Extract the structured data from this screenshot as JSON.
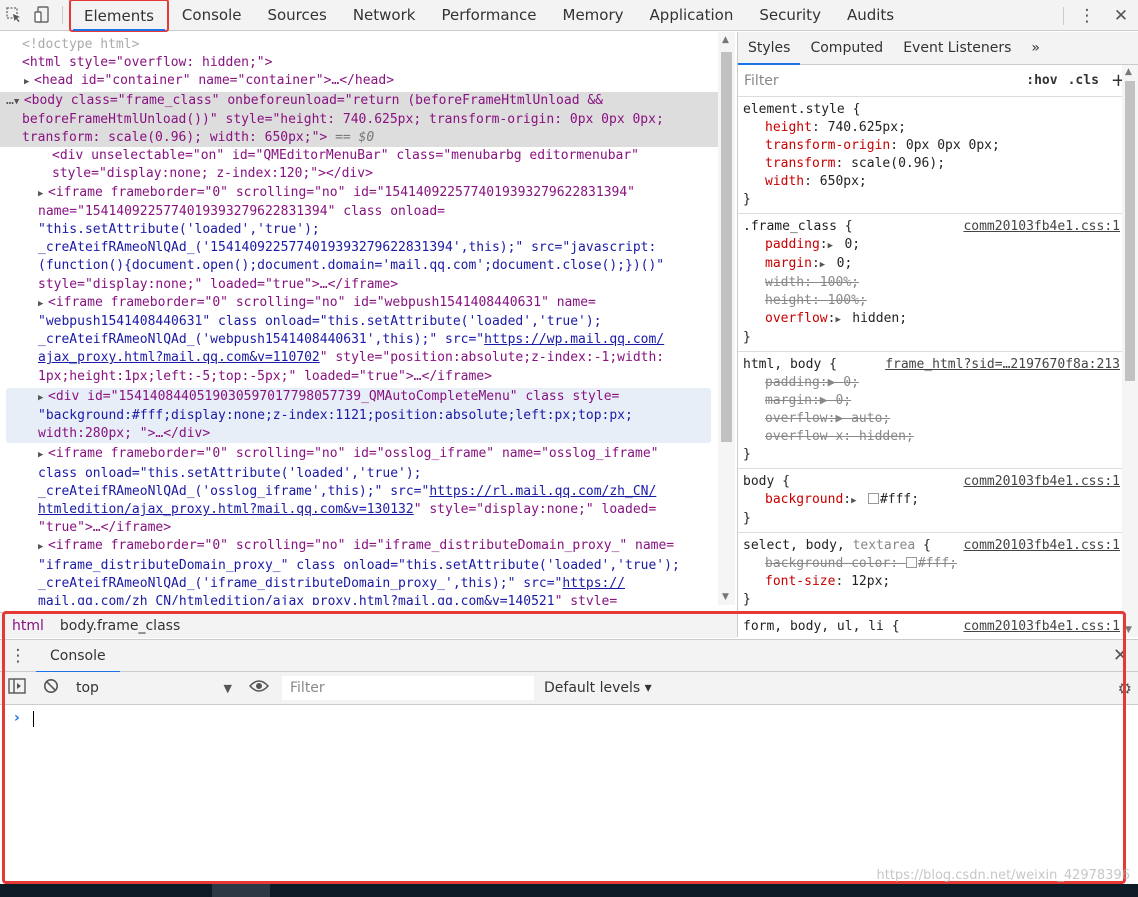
{
  "main_tabs": [
    "Elements",
    "Console",
    "Sources",
    "Network",
    "Performance",
    "Memory",
    "Application",
    "Security",
    "Audits"
  ],
  "active_main_tab": "Elements",
  "icons": {
    "inspect": "cursor-select-icon",
    "device": "device-toggle-icon",
    "more": "kebab-menu-icon",
    "close": "close-icon"
  },
  "dom": {
    "doctype": "<!doctype html>",
    "html_tag": "<html style=\"overflow: hidden;\">",
    "head_tag": "<head id=\"container\" name=\"container\">…</head>",
    "body_l1": "<body class=\"frame_class\" onbeforeunload=\"return (beforeFrameHtmlUnload &&",
    "body_l2": "beforeFrameHtmlUnload())\" style=\"height: 740.625px; transform-origin: 0px 0px 0px;",
    "body_l3": "transform: scale(0.96); width: 650px;\">",
    "body_eq": "== $0",
    "menubar_l1": "<div unselectable=\"on\" id=\"QMEditorMenuBar\" class=\"menubarbg editormenubar\"",
    "menubar_l2": "style=\"display:none; z-index:120;\"></div>",
    "iframe1_l1": "<iframe frameborder=\"0\" scrolling=\"no\" id=\"1541409225774019393279622831394\"",
    "iframe1_l2": "name=\"1541409225774019393279622831394\" class onload=",
    "iframe1_l3": "\"this.setAttribute('loaded','true');",
    "iframe1_l4": "_creAteifRAmeoNlQAd_('1541409225774019393279622831394',this);\" src=\"javascript:",
    "iframe1_l5": "(function(){document.open();document.domain='mail.qq.com';document.close();})()\"",
    "iframe1_l6": "style=\"display:none;\" loaded=\"true\">…</iframe>",
    "iframe2_l1": "<iframe frameborder=\"0\" scrolling=\"no\" id=\"webpush1541408440631\" name=",
    "iframe2_l2": "\"webpush1541408440631\" class onload=\"this.setAttribute('loaded','true');",
    "iframe2_l3a": "_creAteifRAmeoNlQAd_('webpush1541408440631',this);\" src=\"",
    "iframe2_l3b": "https://wp.mail.qq.com/",
    "iframe2_l4a": "ajax_proxy.html?mail.qq.com&v=110702",
    "iframe2_l4b": "\" style=\"position:absolute;z-index:-1;width:",
    "iframe2_l5": "1px;height:1px;left:-5;top:-5px;\" loaded=\"true\">…</iframe>",
    "div_l1": "<div id=\"1541408440519030597017798057739_QMAutoCompleteMenu\" class style=",
    "div_l2": "\"background:#fff;display:none;z-index:1121;position:absolute;left:px;top:px;",
    "div_l3": "width:280px; \">…</div>",
    "iframe3_l1": "<iframe frameborder=\"0\" scrolling=\"no\" id=\"osslog_iframe\" name=\"osslog_iframe\"",
    "iframe3_l2": "class onload=\"this.setAttribute('loaded','true');",
    "iframe3_l3a": "_creAteifRAmeoNlQAd_('osslog_iframe',this);\" src=\"",
    "iframe3_l3b": "https://rl.mail.qq.com/zh_CN/",
    "iframe3_l4a": "htmledition/ajax_proxy.html?mail.qq.com&v=130132",
    "iframe3_l4b": "\" style=\"display:none;\" loaded=",
    "iframe3_l5": "\"true\">…</iframe>",
    "iframe4_l1": "<iframe frameborder=\"0\" scrolling=\"no\" id=\"iframe_distributeDomain_proxy_\" name=",
    "iframe4_l2": "\"iframe_distributeDomain_proxy_\" class onload=\"this.setAttribute('loaded','true');",
    "iframe4_l3a": "_creAteifRAmeoNlQAd_('iframe_distributeDomain_proxy_',this);\" src=\"",
    "iframe4_l3b": "https://",
    "iframe4_l4a": "mail.qq.com/zh_CN/htmledition/ajax_proxy.html?mail.qq.com&v=140521",
    "iframe4_l4b": "\" style="
  },
  "styles": {
    "tabs": [
      "Styles",
      "Computed",
      "Event Listeners"
    ],
    "more_tabs": "»",
    "filter_placeholder": "Filter",
    "hov": ":hov",
    "cls": ".cls",
    "add": "+",
    "element_style": {
      "selector": "element.style {",
      "props": [
        {
          "name": "height",
          "value": "740.625px;"
        },
        {
          "name": "transform-origin",
          "value": "0px 0px 0px;"
        },
        {
          "name": "transform",
          "value": "scale(0.96);"
        },
        {
          "name": "width",
          "value": "650px;"
        }
      ]
    },
    "frame_class": {
      "selector": ".frame_class {",
      "source": "comm20103fb4e1.css:1",
      "props": [
        {
          "name": "padding",
          "value": "0;",
          "arrow": true
        },
        {
          "name": "margin",
          "value": "0;",
          "arrow": true
        },
        {
          "name": "width",
          "value": "100%;",
          "struck": true
        },
        {
          "name": "height",
          "value": "100%;",
          "struck": true
        },
        {
          "name": "overflow",
          "value": "hidden;",
          "arrow": true
        }
      ]
    },
    "html_body": {
      "selector": "html, body {",
      "source": "frame_html?sid=…2197670f8a:213",
      "props": [
        {
          "name": "padding",
          "value": "0;",
          "struck": true
        },
        {
          "name": "margin",
          "value": "0;",
          "struck": true
        },
        {
          "name": "overflow",
          "value": "auto;",
          "struck": true
        },
        {
          "name": "overflow-x",
          "value": "hidden;",
          "struck": true
        }
      ]
    },
    "body": {
      "selector": "body {",
      "source": "comm20103fb4e1.css:1",
      "props": [
        {
          "name": "background",
          "value": "#fff;"
        }
      ]
    },
    "select_body": {
      "selector_a": "select, body,",
      "selector_b": "textarea",
      "selector_c": "{",
      "source": "comm20103fb4e1.css:1",
      "props": [
        {
          "name": "background-color",
          "value": "#fff;",
          "struck": true
        },
        {
          "name": "font-size",
          "value": "12px;"
        }
      ]
    },
    "form_rule": {
      "selector": "form, body, ul, li {",
      "source": "comm20103fb4e1.css:1"
    },
    "close_brace": "}"
  },
  "breadcrumbs": [
    "html",
    "body.frame_class"
  ],
  "drawer": {
    "tabs": [
      "Console"
    ],
    "context": "top",
    "filter_placeholder": "Filter",
    "levels": "Default levels ▾",
    "prompt": "›"
  },
  "watermark": "https://blog.csdn.net/weixin_42978396",
  "colors": {
    "highlight_box": "#e53935",
    "active_tab": "#1a73e8"
  }
}
